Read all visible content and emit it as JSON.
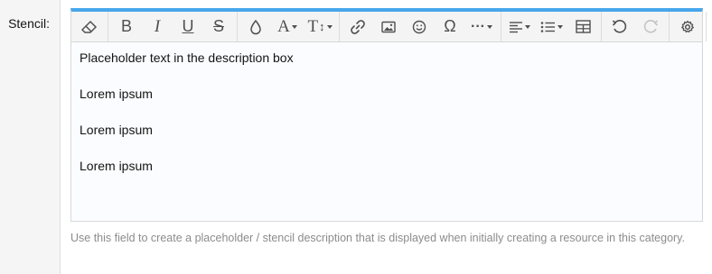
{
  "field": {
    "label": "Stencil:"
  },
  "editor": {
    "accent_color": "#47a7eb",
    "toolbar": [
      {
        "name": "clear-formatting",
        "icon": "eraser-icon"
      },
      {
        "name": "bold",
        "label": "B"
      },
      {
        "name": "italic",
        "label": "I"
      },
      {
        "name": "underline",
        "label": "U"
      },
      {
        "name": "strikethrough",
        "label": "S"
      },
      {
        "name": "text-color",
        "icon": "droplet-icon"
      },
      {
        "name": "font-family",
        "label": "A"
      },
      {
        "name": "font-size",
        "label": "T"
      },
      {
        "name": "insert-link",
        "icon": "link-icon"
      },
      {
        "name": "insert-image",
        "icon": "image-icon"
      },
      {
        "name": "insert-smiley",
        "icon": "smiley-icon"
      },
      {
        "name": "special-characters",
        "label": "Ω"
      },
      {
        "name": "more-options",
        "label": "···"
      },
      {
        "name": "align",
        "icon": "align-left-icon"
      },
      {
        "name": "list",
        "icon": "list-icon"
      },
      {
        "name": "insert-table",
        "icon": "table-icon"
      },
      {
        "name": "undo",
        "icon": "undo-icon"
      },
      {
        "name": "redo",
        "icon": "redo-icon",
        "disabled": true
      },
      {
        "name": "settings",
        "icon": "gear-icon"
      }
    ],
    "content": [
      "Placeholder text in the description box",
      "Lorem ipsum",
      "Lorem ipsum",
      "Lorem ipsum"
    ]
  },
  "help_text": "Use this field to create a placeholder / stencil description that is displayed when initially creating a resource in this category."
}
